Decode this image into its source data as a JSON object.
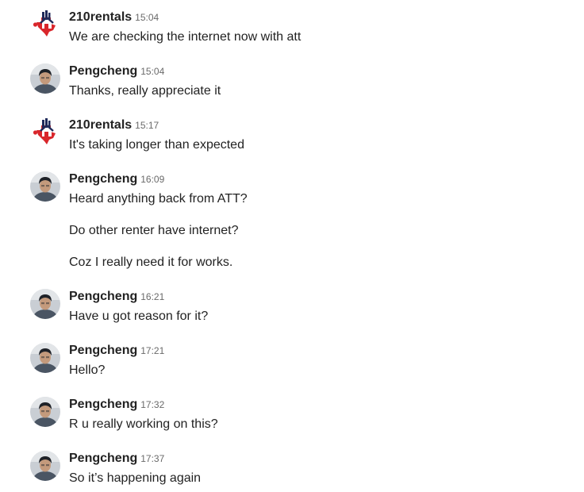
{
  "messages": [
    {
      "sender": "210rentals",
      "time": "15:04",
      "avatar": "rental-logo-icon",
      "lines": [
        "We are checking the internet now with att"
      ]
    },
    {
      "sender": "Pengcheng",
      "time": "15:04",
      "avatar": "user-photo",
      "lines": [
        "Thanks, really appreciate it"
      ]
    },
    {
      "sender": "210rentals",
      "time": "15:17",
      "avatar": "rental-logo-icon",
      "lines": [
        "It's taking longer than expected"
      ]
    },
    {
      "sender": "Pengcheng",
      "time": "16:09",
      "avatar": "user-photo",
      "lines": [
        "Heard anything back from ATT?",
        "Do other renter have internet?",
        "Coz I really need it for works."
      ]
    },
    {
      "sender": "Pengcheng",
      "time": "16:21",
      "avatar": "user-photo",
      "lines": [
        "Have u got reason for it?"
      ]
    },
    {
      "sender": "Pengcheng",
      "time": "17:21",
      "avatar": "user-photo",
      "lines": [
        "Hello?"
      ]
    },
    {
      "sender": "Pengcheng",
      "time": "17:32",
      "avatar": "user-photo",
      "lines": [
        "R u really working on this?"
      ]
    },
    {
      "sender": "Pengcheng",
      "time": "17:37",
      "avatar": "user-photo",
      "lines": [
        "So it’s happening again"
      ]
    }
  ],
  "colors": {
    "text": "#222222",
    "timestamp": "#6a6a6a",
    "logo_red": "#d9262b",
    "logo_navy": "#1f2a5a"
  }
}
